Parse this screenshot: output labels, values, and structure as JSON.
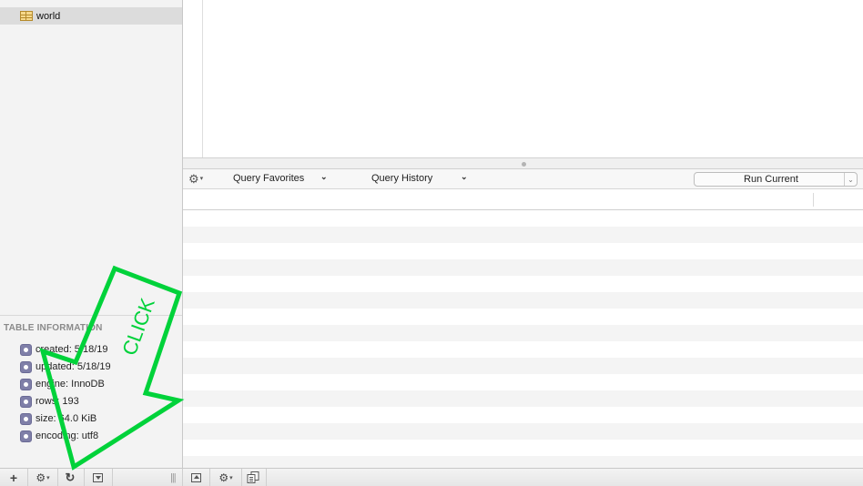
{
  "sidebar": {
    "database_item": {
      "label": "world",
      "icon": "table-icon"
    },
    "table_info": {
      "header": "TABLE INFORMATION",
      "rows": [
        {
          "text": "created: 5/18/19",
          "icon": "info-icon"
        },
        {
          "text": "updated: 5/18/19",
          "icon": "info-icon"
        },
        {
          "text": "engine: InnoDB",
          "icon": "info-icon"
        },
        {
          "text": "rows: 193",
          "icon": "info-icon"
        },
        {
          "text": "size: 64.0 KiB",
          "icon": "info-icon"
        },
        {
          "text": "encoding: utf8",
          "icon": "info-icon"
        }
      ]
    }
  },
  "query_bar": {
    "gear_icon": "⚙",
    "caret": "▾",
    "favorites_label": "Query Favorites",
    "history_label": "Query History",
    "chevron": "⌄",
    "run_label": "Run Current",
    "run_caret": "⌄"
  },
  "bottom_bar": {
    "add_icon": "+",
    "gear_icon": "⚙",
    "caret": "▾",
    "refresh_icon": "↻",
    "resize_handle": "|||"
  },
  "annotation": {
    "text": "CLICK",
    "color": "#00d23a"
  },
  "colors": {
    "sidebar_bg": "#f3f3f3",
    "selected_row_bg": "#dcdcdc",
    "stripe_bg": "#f4f4f4",
    "annotation_green": "#00d23a"
  }
}
